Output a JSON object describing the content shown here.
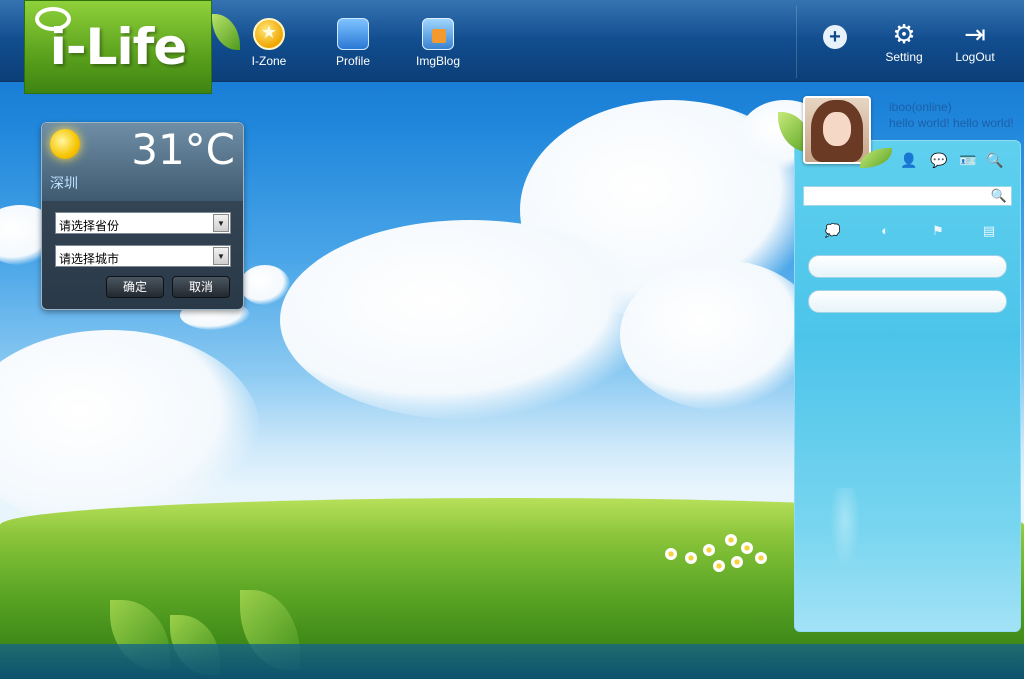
{
  "logo": {
    "text": "i-Life"
  },
  "nav": [
    {
      "label": "I-Zone",
      "icon": "star-icon"
    },
    {
      "label": "Profile",
      "icon": "profile-icon"
    },
    {
      "label": "ImgBlog",
      "icon": "image-blog-icon"
    }
  ],
  "tools": {
    "add_icon": "add-icon",
    "setting_label": "Setting",
    "logout_label": "LogOut"
  },
  "weather": {
    "temperature": "31°C",
    "city": "深圳",
    "province_select": "请选择省份",
    "city_select": "请选择城市",
    "confirm_label": "确定",
    "cancel_label": "取消"
  },
  "user": {
    "name": "iboo(online)",
    "status": "hello world! hello world!"
  },
  "panel": {
    "search_placeholder": ""
  },
  "colors": {
    "topbar": "#104a8a",
    "logo_green": "#5aa11d",
    "panel": "#4cc4ea",
    "user_text": "#1d5fa8"
  }
}
